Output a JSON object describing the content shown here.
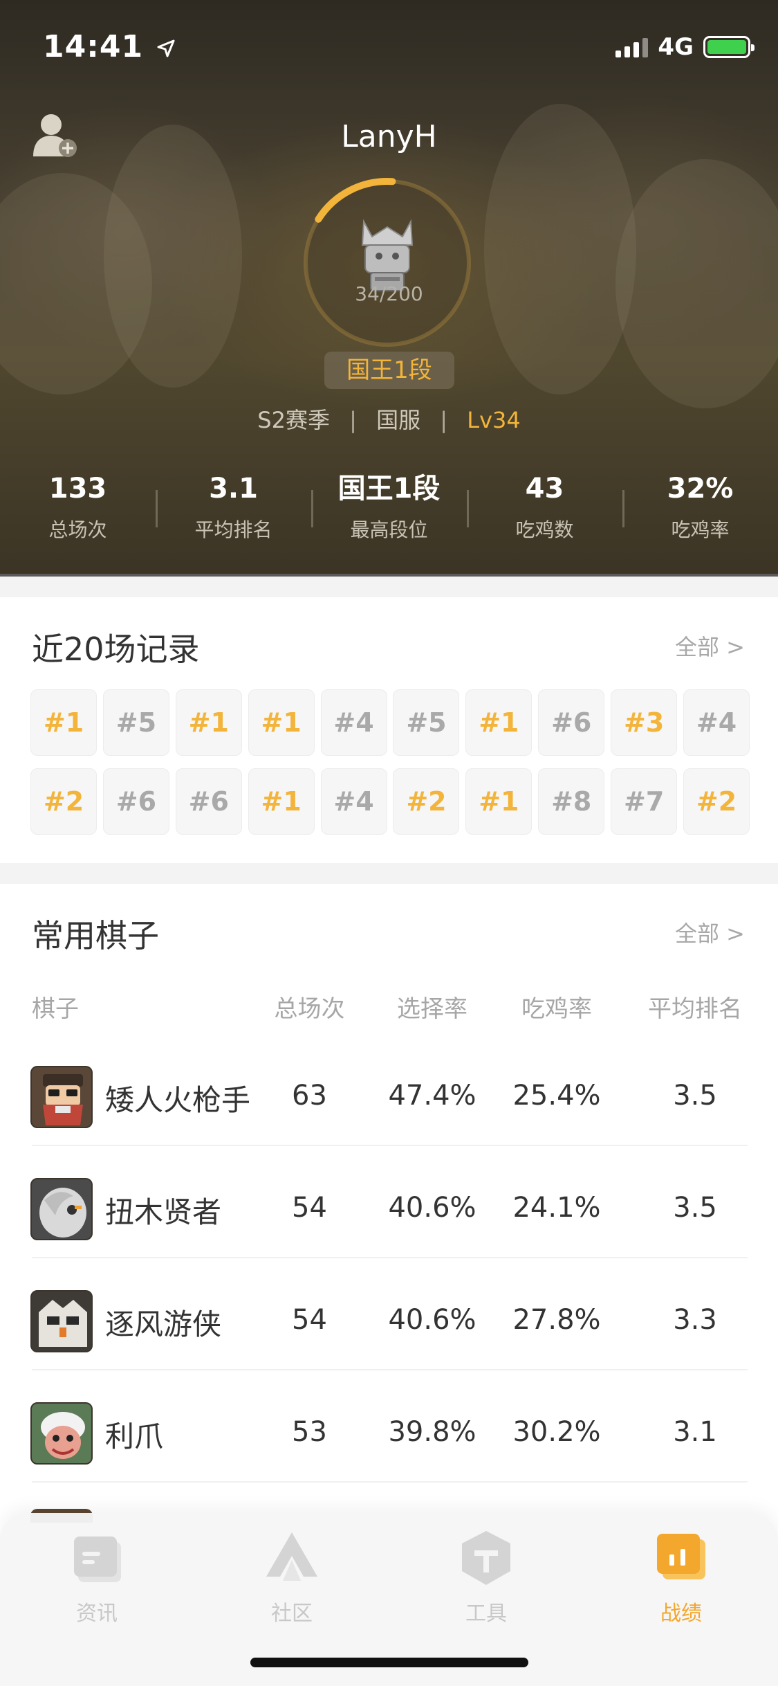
{
  "status": {
    "time": "14:41",
    "network": "4G"
  },
  "profile": {
    "username": "LanyH",
    "progress": "34/200",
    "progress_fraction": 0.17,
    "rank": "国王1段",
    "season": "S2赛季",
    "server": "国服",
    "level": "Lv34",
    "separator": "|"
  },
  "stats": [
    {
      "value": "133",
      "label": "总场次"
    },
    {
      "value": "3.1",
      "label": "平均排名"
    },
    {
      "value": "国王1段",
      "label": "最高段位"
    },
    {
      "value": "43",
      "label": "吃鸡数"
    },
    {
      "value": "32%",
      "label": "吃鸡率"
    }
  ],
  "recent": {
    "title": "近20场记录",
    "more": "全部 >",
    "records": [
      "#1",
      "#5",
      "#1",
      "#1",
      "#4",
      "#5",
      "#1",
      "#6",
      "#3",
      "#4",
      "#2",
      "#6",
      "#6",
      "#1",
      "#4",
      "#2",
      "#1",
      "#8",
      "#7",
      "#2"
    ]
  },
  "pieces": {
    "title": "常用棋子",
    "more": "全部 >",
    "headers": {
      "name": "棋子",
      "games": "总场次",
      "pick": "选择率",
      "win": "吃鸡率",
      "avg": "平均排名"
    },
    "rows": [
      {
        "name": "矮人火枪手",
        "games": "63",
        "pick": "47.4%",
        "win": "25.4%",
        "avg": "3.5"
      },
      {
        "name": "扭木贤者",
        "games": "54",
        "pick": "40.6%",
        "win": "24.1%",
        "avg": "3.5"
      },
      {
        "name": "逐风游侠",
        "games": "54",
        "pick": "40.6%",
        "win": "27.8%",
        "avg": "3.3"
      },
      {
        "name": "利爪",
        "games": "53",
        "pick": "39.8%",
        "win": "30.2%",
        "avg": "3.1"
      }
    ]
  },
  "tabs": [
    {
      "label": "资讯",
      "icon": "news-icon"
    },
    {
      "label": "社区",
      "icon": "community-icon"
    },
    {
      "label": "工具",
      "icon": "tools-icon"
    },
    {
      "label": "战绩",
      "icon": "stats-icon",
      "active": true
    }
  ],
  "colors": {
    "accent": "#f3b43b",
    "tab_active": "#f3a72c"
  }
}
